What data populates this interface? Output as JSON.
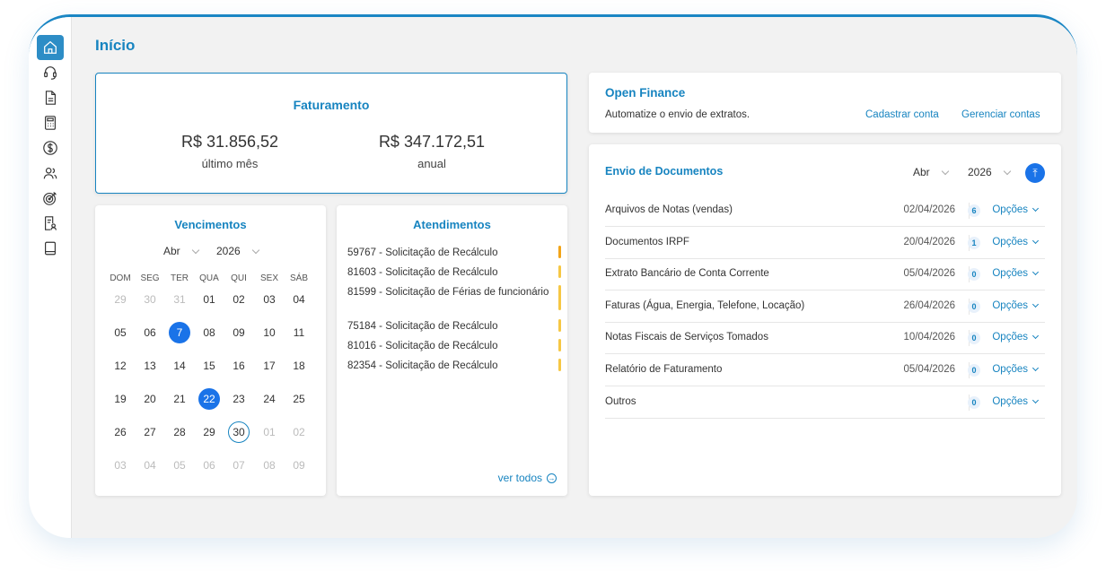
{
  "page_title": "Início",
  "sidebar": {
    "items": [
      "home-icon",
      "headset-icon",
      "document-icon",
      "calculator-icon",
      "dollar-icon",
      "users-icon",
      "target-icon",
      "user-document-icon",
      "book-icon"
    ]
  },
  "faturamento": {
    "title": "Faturamento",
    "ultimo_mes_value": "R$ 31.856,52",
    "ultimo_mes_label": "último mês",
    "anual_value": "R$ 347.172,51",
    "anual_label": "anual"
  },
  "vencimentos": {
    "title": "Vencimentos",
    "month": "Abr",
    "year": "2026",
    "weekdays": [
      "DOM",
      "SEG",
      "TER",
      "QUA",
      "QUI",
      "SEX",
      "SÁB"
    ],
    "weeks": [
      [
        "29",
        "30",
        "31",
        "01",
        "02",
        "03",
        "04"
      ],
      [
        "05",
        "06",
        "7",
        "08",
        "09",
        "10",
        "11"
      ],
      [
        "12",
        "13",
        "14",
        "15",
        "16",
        "17",
        "18"
      ],
      [
        "19",
        "20",
        "21",
        "22",
        "23",
        "24",
        "25"
      ],
      [
        "26",
        "27",
        "28",
        "29",
        "30",
        "01",
        "02"
      ],
      [
        "03",
        "04",
        "05",
        "06",
        "07",
        "08",
        "09"
      ]
    ]
  },
  "atendimentos": {
    "title": "Atendimentos",
    "items": [
      "59767 - Solicitação de Recálculo",
      "81603 - Solicitação de Recálculo",
      "81599 - Solicitação de Férias de funcionário",
      "75184 - Solicitação de Recálculo",
      "81016 - Solicitação de Recálculo",
      "82354 - Solicitação de Recálculo"
    ],
    "ver_todos": "ver todos"
  },
  "open_finance": {
    "title": "Open Finance",
    "text": "Automatize o envio de extratos.",
    "cadastrar": "Cadastrar conta",
    "gerenciar": "Gerenciar contas"
  },
  "envio": {
    "title": "Envio de Documentos",
    "month": "Abr",
    "year": "2026",
    "options_label": "Opções",
    "rows": [
      {
        "name": "Arquivos de Notas (vendas)",
        "date": "02/04/2026",
        "count": "6"
      },
      {
        "name": "Documentos IRPF",
        "date": "20/04/2026",
        "count": "1"
      },
      {
        "name": "Extrato Bancário de Conta Corrente",
        "date": "05/04/2026",
        "count": "0"
      },
      {
        "name": "Faturas (Água, Energia, Telefone, Locação)",
        "date": "26/04/2026",
        "count": "0"
      },
      {
        "name": "Notas Fiscais de Serviços Tomados",
        "date": "10/04/2026",
        "count": "0"
      },
      {
        "name": "Relatório de Faturamento",
        "date": "05/04/2026",
        "count": "0"
      },
      {
        "name": "Outros",
        "date": "",
        "count": "0"
      }
    ]
  },
  "colors": {
    "accent": "#1784c0",
    "selected": "#1a73e8",
    "ticket_bar": "#f6c744"
  }
}
